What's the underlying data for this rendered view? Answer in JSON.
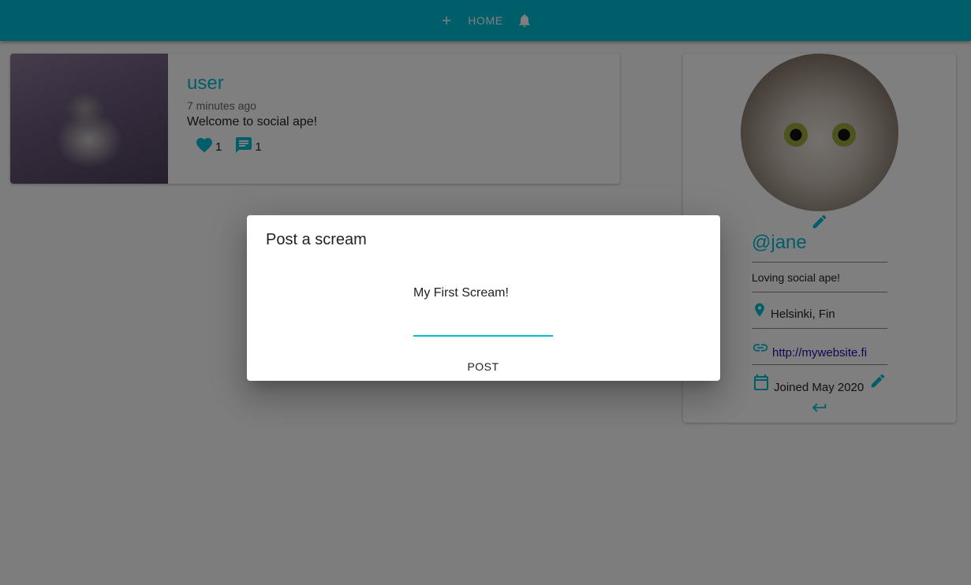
{
  "colors": {
    "primary": "#00bcd4",
    "link": "#1a0dab",
    "backdrop": "rgba(0,0,0,0.5)"
  },
  "navbar": {
    "add_icon": "plus-icon",
    "home_label": "HOME",
    "notifications_icon": "bell-icon"
  },
  "scream": {
    "user_handle": "user",
    "time_ago": "7 minutes ago",
    "body": "Welcome to social ape!",
    "like_count": "1",
    "comment_count": "1",
    "like_icon": "heart-icon",
    "comment_icon": "chat-icon"
  },
  "profile": {
    "handle": "@jane",
    "bio": "Loving social ape!",
    "location": "Helsinki, Fin",
    "website": "http://mywebsite.fi",
    "joined": "Joined May 2020",
    "edit_image_icon": "pencil-icon",
    "edit_details_icon": "pencil-icon",
    "logout_icon": "keyboard-return-icon"
  },
  "dialog": {
    "title": "Post a scream",
    "input_value": "My First Scream!",
    "post_label": "POST"
  }
}
